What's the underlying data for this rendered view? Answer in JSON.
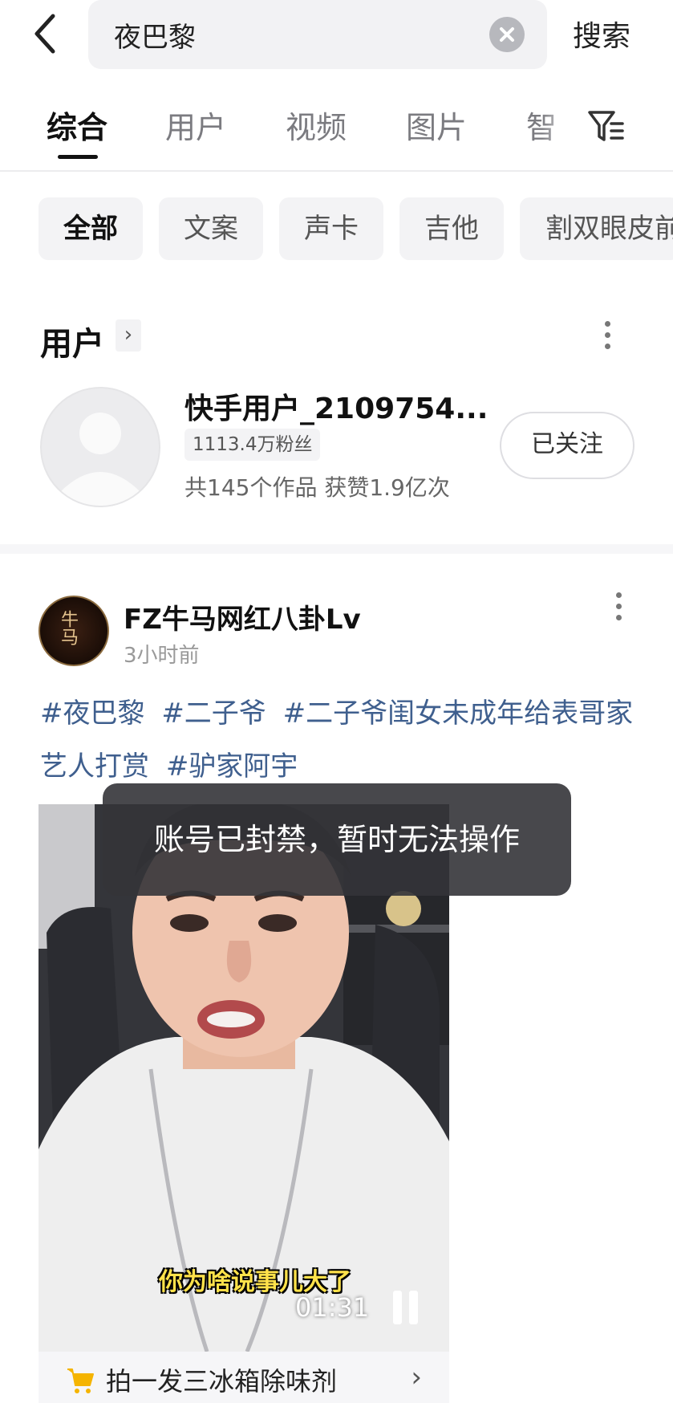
{
  "search": {
    "query": "夜巴黎",
    "action_label": "搜索"
  },
  "tabs": [
    {
      "label": "综合",
      "active": true
    },
    {
      "label": "用户"
    },
    {
      "label": "视频"
    },
    {
      "label": "图片"
    },
    {
      "label": "智"
    }
  ],
  "chips": [
    {
      "label": "全部",
      "active": true
    },
    {
      "label": "文案"
    },
    {
      "label": "声卡"
    },
    {
      "label": "吉他"
    },
    {
      "label": "割双眼皮前"
    }
  ],
  "user_section": {
    "title": "用户",
    "arrow": "›",
    "user": {
      "name": "快手用户_2109754...",
      "fans": "1113.4万粉丝",
      "stats": "共145个作品 获赞1.9亿次",
      "follow_label": "已关注"
    }
  },
  "post": {
    "author": "FZ牛马网红八卦Lv",
    "avatar_text": "牛马",
    "time": "3小时前",
    "hashtags": [
      "#夜巴黎",
      "#二子爷",
      "#二子爷闺女未成年给表哥家艺人打赏",
      "#驴家阿宇"
    ],
    "video": {
      "subtitle": "你为啥说事儿大了",
      "duration": "01:31"
    },
    "product": {
      "label": "拍一发三冰箱除味剂",
      "arrow": "›"
    }
  },
  "toast": {
    "message": "账号已封禁，暂时无法操作"
  },
  "colors": {
    "hashtag": "#3f5f8e",
    "chip_bg": "#f3f3f5",
    "toast_bg": "#343438",
    "cart_icon": "#f5b400"
  },
  "icons": {
    "back": "back-arrow-icon",
    "clear": "clear-icon",
    "filter": "filter-icon",
    "more": "more-icon",
    "pause": "pause-icon",
    "cart": "cart-icon"
  }
}
